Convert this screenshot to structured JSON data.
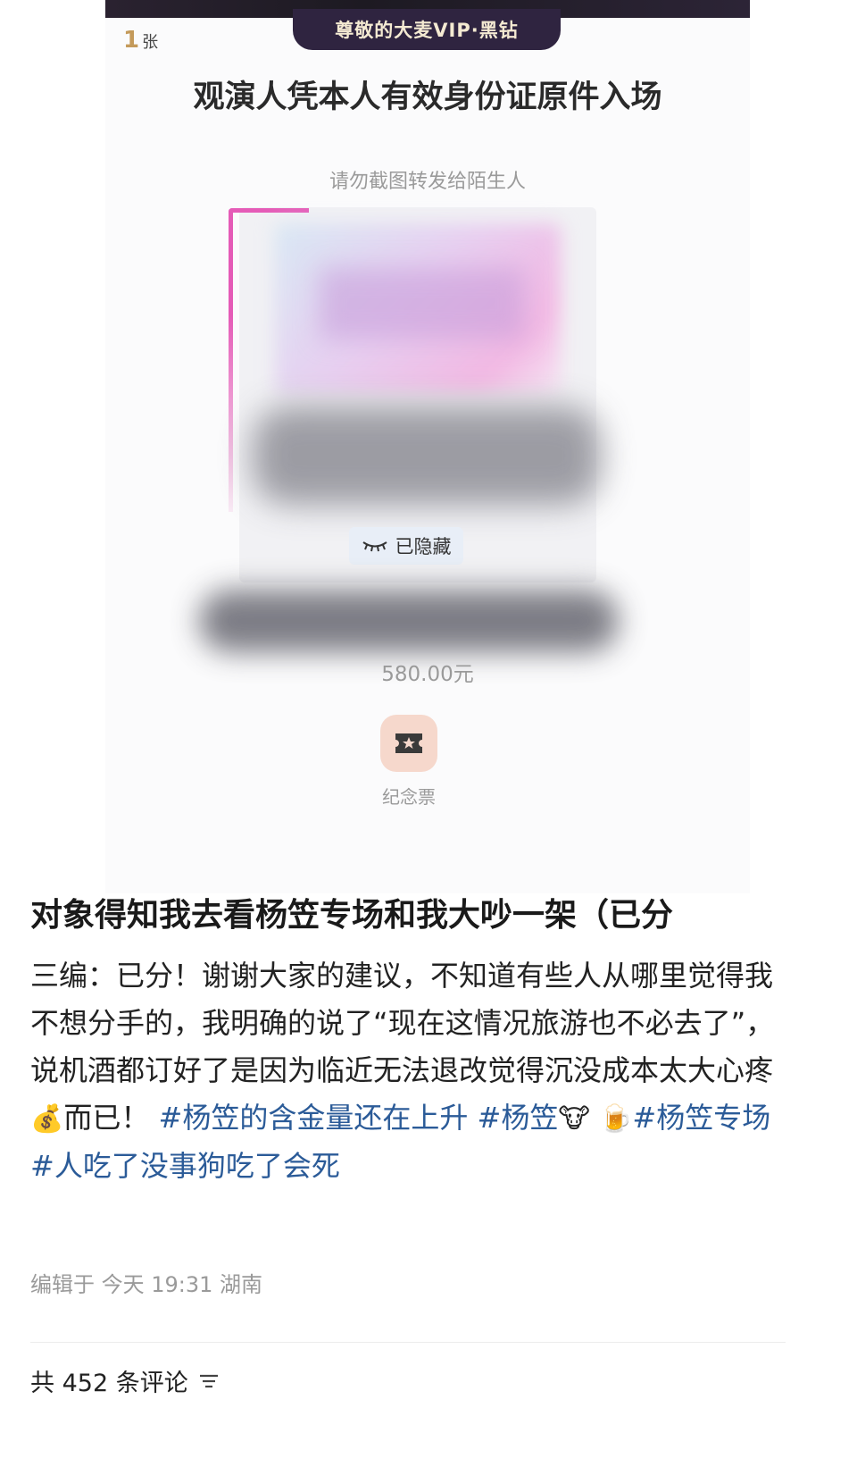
{
  "ticket": {
    "vip_label": "尊敬的大麦VIP·黑钻",
    "quantity_num": "1",
    "quantity_unit": "张",
    "notice_title": "观演人凭本人有效身份证原件入场",
    "notice_sub": "请勿截图转发给陌生人",
    "hidden_label": "已隐藏",
    "price": "580.00元",
    "souvenir_label": "纪念票"
  },
  "post": {
    "title": "对象得知我去看杨笠专场和我大吵一架（已分",
    "body_text_1": "三编：已分！谢谢大家的建议，不知道有些人从哪里觉得我不想分手的，我明确的说了“现在这情况旅游也不必去了”，说机酒都订好了是因为临近无法退改觉得沉没成本太大心疼",
    "emoji_money": "💰",
    "body_text_2": "而已！",
    "tag_1": "#杨笠的含金量还在上升",
    "tag_2": "#杨笠",
    "emoji_cow": "🐮",
    "emoji_beer": "🍺",
    "tag_3": "#杨笠专场",
    "tag_4": "#人吃了没事狗吃了会死",
    "edit_meta": "编辑于 今天 19:31 湖南",
    "comments_label": "共 452 条评论"
  },
  "icons": {
    "eye": "closed-eye-icon",
    "souvenir": "ticket-star-icon",
    "sort": "sort-lines-icon"
  },
  "colors": {
    "accent_pink": "#e55bb7",
    "tag_blue": "#2b5b98",
    "vip_bg": "#2f2440"
  }
}
